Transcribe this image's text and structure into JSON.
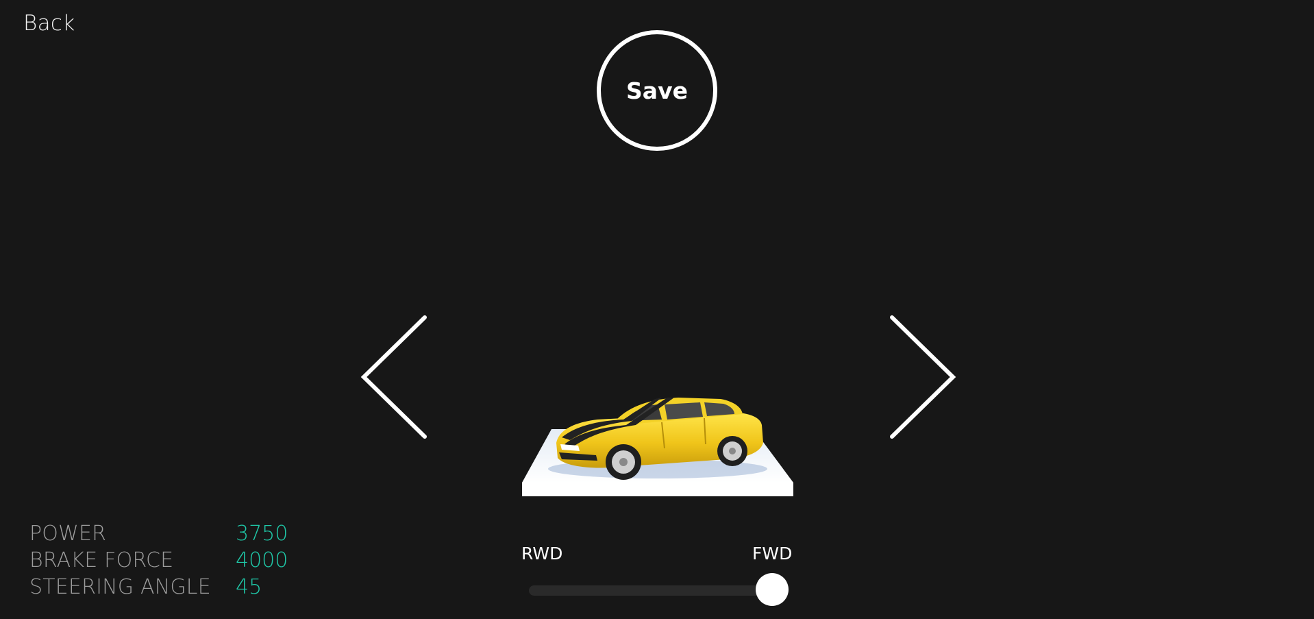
{
  "nav": {
    "back_label": "Back"
  },
  "actions": {
    "save_label": "Save"
  },
  "stats": [
    {
      "label": "POWER",
      "value": "3750"
    },
    {
      "label": "BRAKE FORCE",
      "value": "4000"
    },
    {
      "label": "STEERING ANGLE",
      "value": "45"
    }
  ],
  "drivetrain": {
    "left_label": "RWD",
    "right_label": "FWD",
    "value_fraction": 1.0
  },
  "colors": {
    "background": "#171717",
    "stat_value": "#1fc8a8",
    "car_body": "#f2cf1f",
    "platform": "#ffffff"
  },
  "icons": {
    "prev": "chevron-left-icon",
    "next": "chevron-right-icon"
  }
}
